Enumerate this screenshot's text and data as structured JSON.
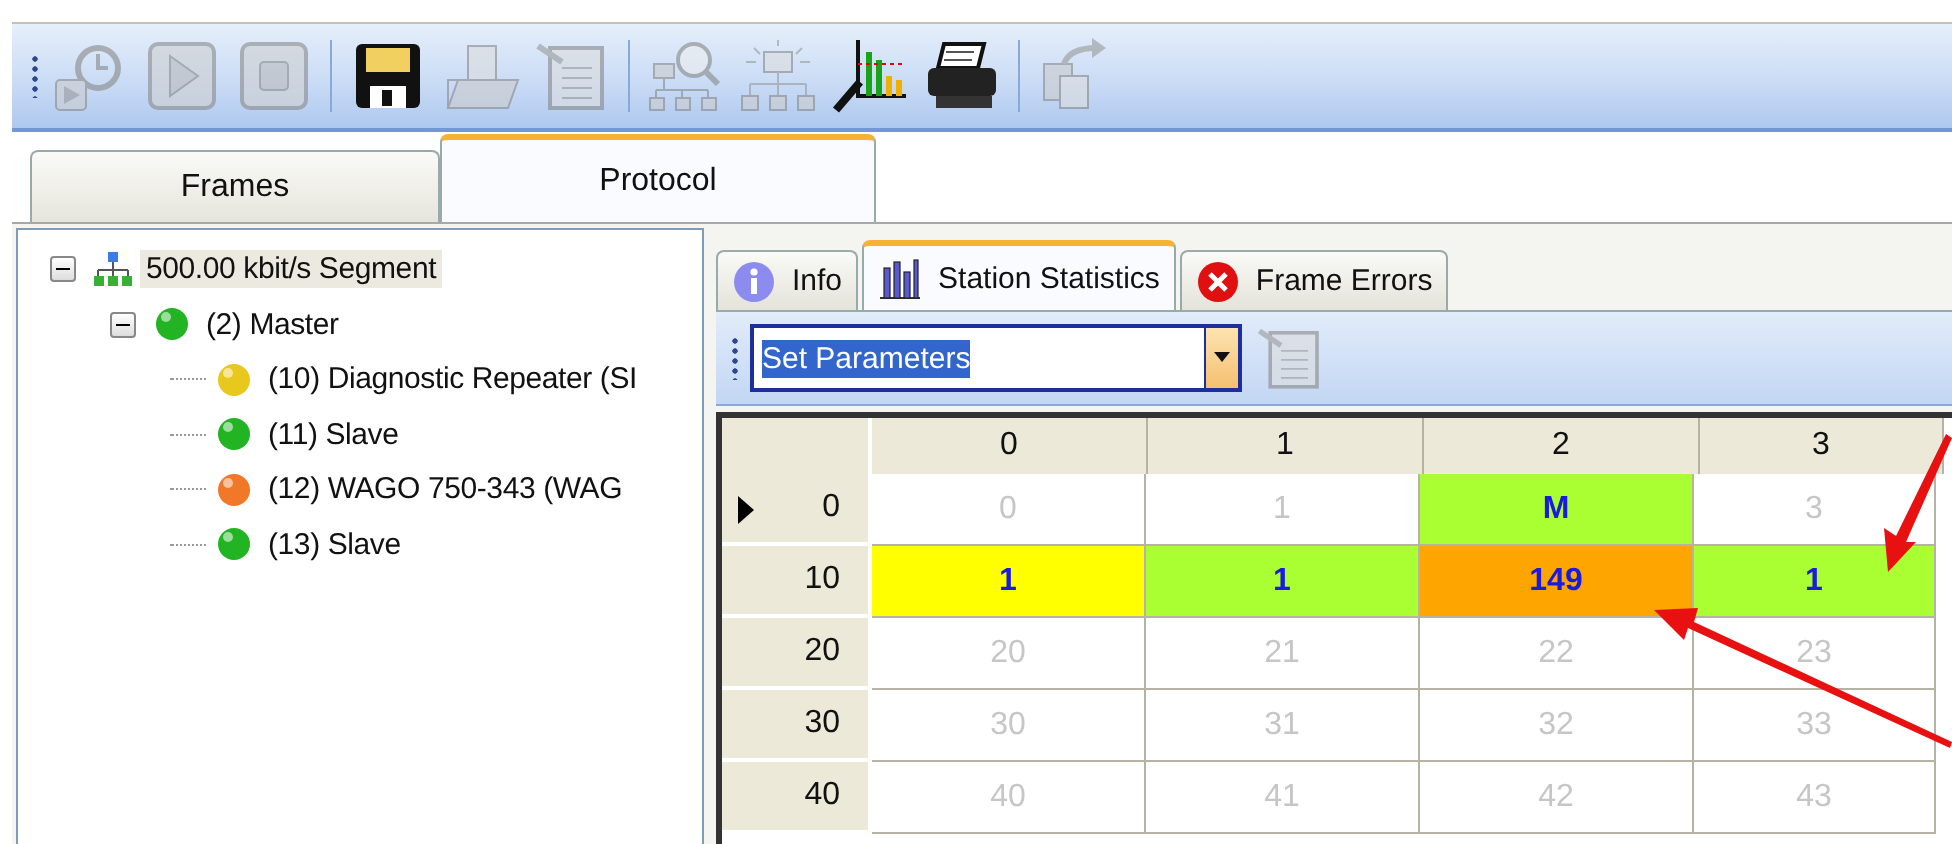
{
  "toolbar": [
    {
      "kind": "timer-play",
      "disabled": true
    },
    {
      "kind": "play",
      "disabled": true
    },
    {
      "kind": "stop",
      "disabled": true
    },
    {
      "kind": "separator"
    },
    {
      "kind": "save",
      "disabled": false
    },
    {
      "kind": "open",
      "disabled": true
    },
    {
      "kind": "export",
      "disabled": true
    },
    {
      "kind": "separator"
    },
    {
      "kind": "network-search",
      "disabled": true
    },
    {
      "kind": "network-config",
      "disabled": true
    },
    {
      "kind": "chart-tools",
      "disabled": false
    },
    {
      "kind": "print",
      "disabled": false
    },
    {
      "kind": "separator"
    },
    {
      "kind": "copy",
      "disabled": true
    }
  ],
  "main_tabs": [
    {
      "label": "Frames",
      "selected": false
    },
    {
      "label": "Protocol",
      "selected": true
    }
  ],
  "tree": [
    {
      "label": "500.00 kbit/s Segment",
      "kind": "segment",
      "expanded": true,
      "selected": true,
      "children": [
        {
          "label": "(2) Master",
          "kind": "station",
          "color": "#22b422",
          "expanded": true,
          "selected": false,
          "children": [
            {
              "label": "(10) Diagnostic Repeater (SI",
              "kind": "station",
              "color": "#e8c81c",
              "selected": false
            },
            {
              "label": "(11) Slave",
              "kind": "station",
              "color": "#22b422",
              "selected": false
            },
            {
              "label": "(12) WAGO 750-343 (WAG",
              "kind": "station",
              "color": "#f07828",
              "selected": false
            },
            {
              "label": "(13) Slave",
              "kind": "station",
              "color": "#22b422",
              "selected": false
            }
          ]
        }
      ]
    }
  ],
  "detail_tabs": [
    {
      "label": "Info",
      "kind": "info",
      "selected": false
    },
    {
      "label": "Station Statistics",
      "kind": "statistics",
      "selected": true
    },
    {
      "label": "Frame Errors",
      "kind": "errors",
      "selected": false
    }
  ],
  "command_select": {
    "value": "Set Parameters"
  },
  "export_button": {
    "disabled": true
  },
  "grid": {
    "columns": [
      "0",
      "1",
      "2",
      "3"
    ],
    "rows": [
      {
        "header": "0",
        "current": true,
        "cells": [
          {
            "text": "0",
            "kind": "empty"
          },
          {
            "text": "1",
            "kind": "empty"
          },
          {
            "text": "M",
            "kind": "station",
            "color": "#aaff33"
          },
          {
            "text": "3",
            "kind": "empty"
          }
        ]
      },
      {
        "header": "10",
        "current": false,
        "cells": [
          {
            "text": "1",
            "kind": "station",
            "color": "#ffff00"
          },
          {
            "text": "1",
            "kind": "station",
            "color": "#aaff33"
          },
          {
            "text": "149",
            "kind": "station",
            "color": "#ffa500"
          },
          {
            "text": "1",
            "kind": "station",
            "color": "#aaff33"
          }
        ]
      },
      {
        "header": "20",
        "current": false,
        "cells": [
          {
            "text": "20",
            "kind": "empty"
          },
          {
            "text": "21",
            "kind": "empty"
          },
          {
            "text": "22",
            "kind": "empty"
          },
          {
            "text": "23",
            "kind": "empty"
          }
        ]
      },
      {
        "header": "30",
        "current": false,
        "cells": [
          {
            "text": "30",
            "kind": "empty"
          },
          {
            "text": "31",
            "kind": "empty"
          },
          {
            "text": "32",
            "kind": "empty"
          },
          {
            "text": "33",
            "kind": "empty"
          }
        ]
      },
      {
        "header": "40",
        "current": false,
        "cells": [
          {
            "text": "40",
            "kind": "empty"
          },
          {
            "text": "41",
            "kind": "empty"
          },
          {
            "text": "42",
            "kind": "empty"
          },
          {
            "text": "43",
            "kind": "empty"
          }
        ]
      }
    ]
  }
}
